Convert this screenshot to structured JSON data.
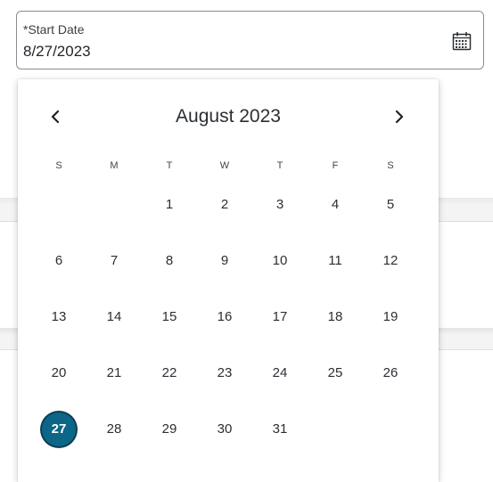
{
  "field": {
    "label": "*Start Date",
    "value": "8/27/2023",
    "icon": "calendar-icon"
  },
  "calendar": {
    "month_title": "August 2023",
    "prev_icon": "chevron-left-icon",
    "next_icon": "chevron-right-icon",
    "weekdays": [
      "S",
      "M",
      "T",
      "W",
      "T",
      "F",
      "S"
    ],
    "weeks": [
      [
        "",
        "",
        "1",
        "2",
        "3",
        "4",
        "5"
      ],
      [
        "6",
        "7",
        "8",
        "9",
        "10",
        "11",
        "12"
      ],
      [
        "13",
        "14",
        "15",
        "16",
        "17",
        "18",
        "19"
      ],
      [
        "20",
        "21",
        "22",
        "23",
        "24",
        "25",
        "26"
      ],
      [
        "27",
        "28",
        "29",
        "30",
        "31",
        "",
        ""
      ]
    ],
    "selected_day": "27",
    "selected_color": "#0b6688"
  }
}
